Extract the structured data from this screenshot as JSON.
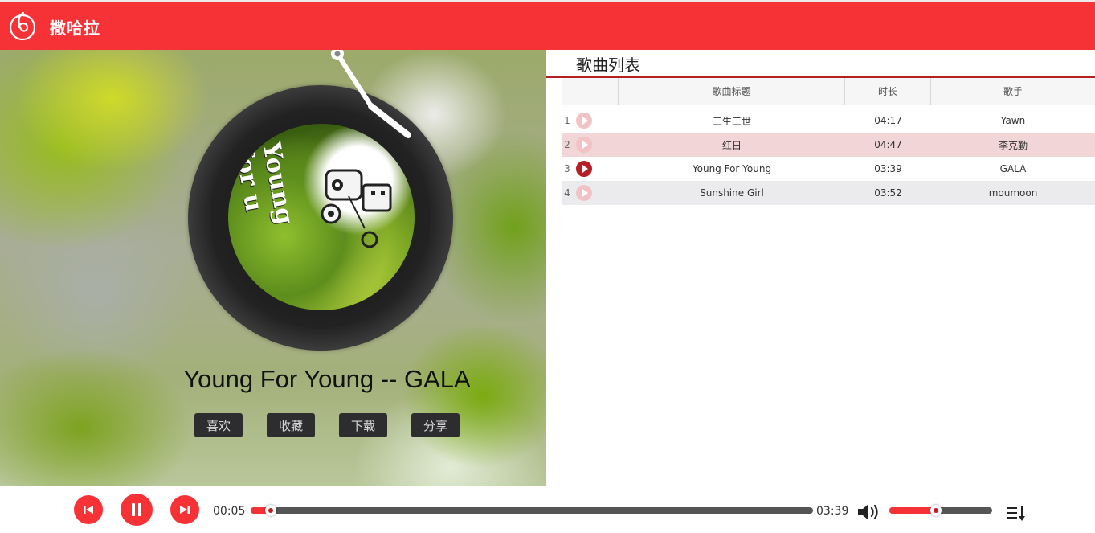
{
  "header": {
    "title": "撒哈拉",
    "logo_icon": "music-note-icon",
    "color": "#f63237"
  },
  "now_playing": {
    "song": "Young For Young",
    "artist": "GALA",
    "display_title": "Young For Young -- GALA",
    "cover_text": "Young for u",
    "actions": [
      "喜欢",
      "收藏",
      "下载",
      "分享"
    ]
  },
  "playlist": {
    "title": "歌曲列表",
    "columns": [
      "",
      "歌曲标题",
      "时长",
      "歌手"
    ],
    "rows": [
      {
        "num": "1",
        "title": "三生三世",
        "duration": "04:17",
        "artist": "Yawn"
      },
      {
        "num": "2",
        "title": "红日",
        "duration": "04:47",
        "artist": "李克勤"
      },
      {
        "num": "3",
        "title": "Young For Young",
        "duration": "03:39",
        "artist": "GALA"
      },
      {
        "num": "4",
        "title": "Sunshine Girl",
        "duration": "03:52",
        "artist": "moumoon"
      }
    ],
    "active_index": 2
  },
  "player": {
    "current_time": "00:05",
    "total_time": "03:39",
    "progress_fraction": 0.035,
    "volume_fraction": 0.45,
    "icons": [
      "previous-icon",
      "pause-icon",
      "next-icon",
      "volume-icon",
      "playlist-icon"
    ]
  }
}
